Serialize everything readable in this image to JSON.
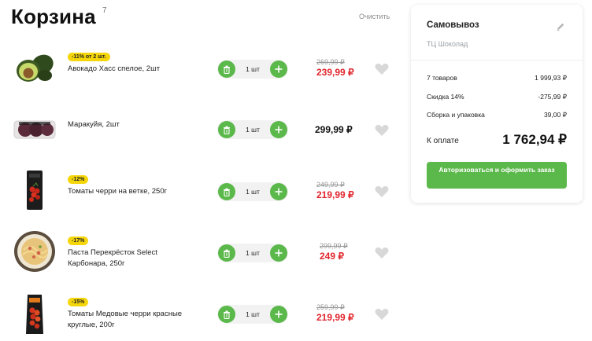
{
  "cart": {
    "title": "Корзина",
    "count": "7",
    "clear_label": "Очистить"
  },
  "items": [
    {
      "name": "Авокадо Хасс спелое, 2шт",
      "badge": "-11% от 2 шт.",
      "qty": "1 шт",
      "old_price": "269,99 ₽",
      "price": "239,99 ₽",
      "thumb_icon": "avocado-image"
    },
    {
      "name": "Маракуйя, 2шт",
      "qty": "1 шт",
      "price": "299,99 ₽",
      "thumb_icon": "passion-fruit-image"
    },
    {
      "name": "Томаты черри на ветке, 250г",
      "badge": "-12%",
      "qty": "1 шт",
      "old_price": "249,99 ₽",
      "price": "219,99 ₽",
      "thumb_icon": "cherry-tomatoes-pack-image"
    },
    {
      "name": "Паста Перекрёсток Select Карбонара, 250г",
      "badge": "-17%",
      "qty": "1 шт",
      "old_price": "299,99 ₽",
      "price": "249 ₽",
      "thumb_icon": "pasta-carbonara-image"
    },
    {
      "name": "Томаты Медовые черри красные круглые, 200г",
      "badge": "-15%",
      "qty": "1 шт",
      "old_price": "259,99 ₽",
      "price": "219,99 ₽",
      "thumb_icon": "honey-cherry-tomatoes-image"
    }
  ],
  "summary": {
    "delivery_title": "Самовывоз",
    "store": "ТЦ Шоколад",
    "rows": [
      {
        "label": "7 товаров",
        "value": "1 999,93 ₽"
      },
      {
        "label": "Скидка 14%",
        "value": "-275,99 ₽"
      },
      {
        "label": "Сборка и упаковка",
        "value": "39,00 ₽"
      }
    ],
    "pay_label": "К оплате",
    "total": "1 762,94 ₽",
    "checkout_label": "Авторизоваться и оформить заказ"
  },
  "colors": {
    "accent_green": "#5bb84a",
    "sale_red": "#e0262d",
    "badge_yellow": "#f5d60a"
  },
  "icons": {
    "minus": "trash-icon",
    "plus": "plus-icon",
    "favorite": "heart-icon",
    "edit": "pencil-icon"
  }
}
